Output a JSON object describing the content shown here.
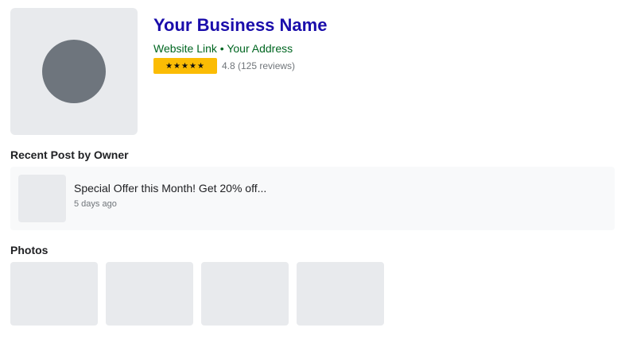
{
  "business": {
    "name": "Your Business Name",
    "website_link": "Website Link",
    "separator": " • ",
    "address": "Your Address",
    "stars": "★★★★★",
    "rating_text": "4.8 (125 reviews)",
    "accent_color": "#fbbc04",
    "name_color": "#1a0dab",
    "link_color": "#006621"
  },
  "recent_post": {
    "section_title": "Recent Post by Owner",
    "title": "Special Offer this Month! Get 20% off...",
    "time": "5 days ago"
  },
  "photos": {
    "section_title": "Photos",
    "count": 4
  }
}
